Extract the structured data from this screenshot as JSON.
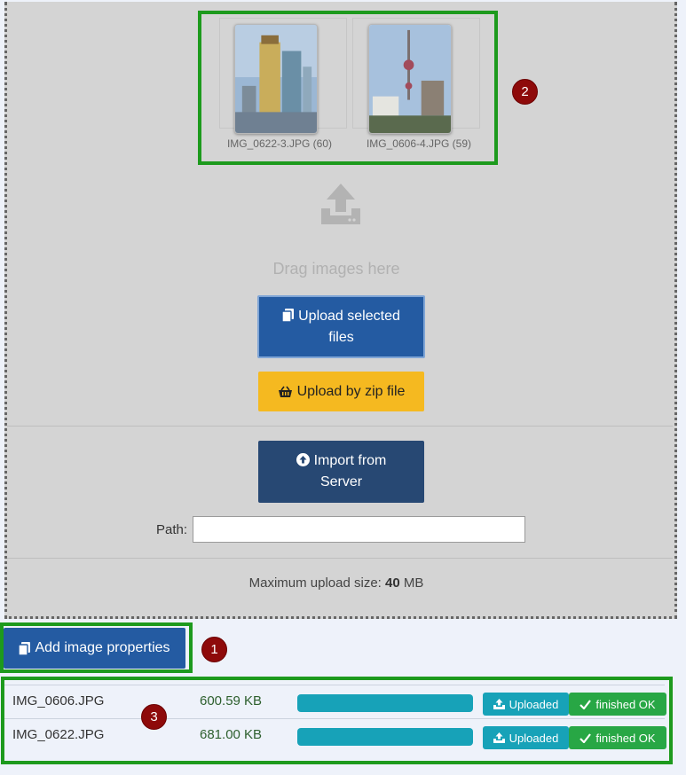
{
  "thumbnails": [
    {
      "caption": "IMG_0622-3.JPG (60)"
    },
    {
      "caption": "IMG_0606-4.JPG (59)"
    }
  ],
  "dropzone": {
    "drag_text": "Drag images here",
    "upload_selected_label": "Upload selected files",
    "upload_zip_label": "Upload by zip file",
    "import_server_label": "Import from Server",
    "path_label": "Path:",
    "path_value": "",
    "max_upload_prefix": "Maximum upload size:",
    "max_upload_value": "40",
    "max_upload_unit": "MB"
  },
  "add_properties_label": "Add image properties",
  "badges": [
    "1",
    "2",
    "3"
  ],
  "files": [
    {
      "name": "IMG_0606.JPG",
      "size": "600.59 KB",
      "progress": 1.0,
      "uploaded_label": "Uploaded",
      "finished_label": "finished OK"
    },
    {
      "name": "IMG_0622.JPG",
      "size": "681.00 KB",
      "progress": 1.0,
      "uploaded_label": "Uploaded",
      "finished_label": "finished OK"
    }
  ],
  "colors": {
    "primary": "#245ba2",
    "warning": "#f5b920",
    "dark_primary": "#274873",
    "info": "#17a2b8",
    "success": "#28a745",
    "highlight": "#1d9a1d",
    "badge": "#8e0a0a"
  }
}
